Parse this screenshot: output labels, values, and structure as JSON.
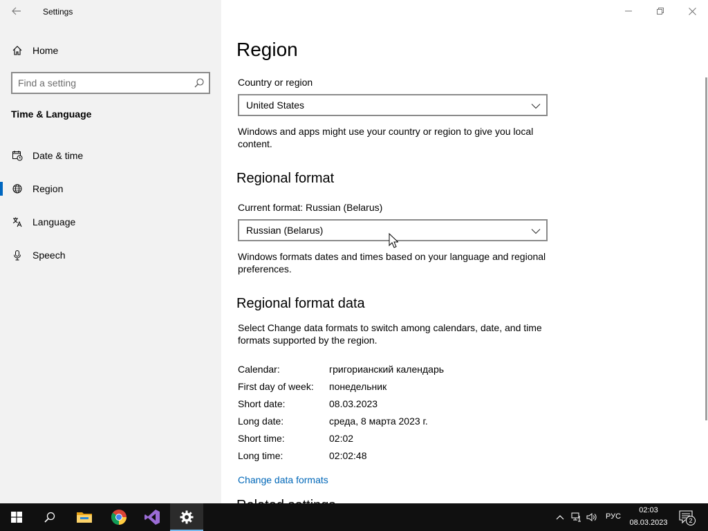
{
  "window": {
    "title": "Settings"
  },
  "sidebar": {
    "home_label": "Home",
    "search_placeholder": "Find a setting",
    "section_title": "Time & Language",
    "items": [
      {
        "label": "Date & time",
        "icon": "calendar-clock-icon"
      },
      {
        "label": "Region",
        "icon": "globe-icon",
        "active": true
      },
      {
        "label": "Language",
        "icon": "language-icon"
      },
      {
        "label": "Speech",
        "icon": "microphone-icon"
      }
    ]
  },
  "main": {
    "title": "Region",
    "country": {
      "label": "Country or region",
      "value": "United States",
      "description": "Windows and apps might use your country or region to give you local content."
    },
    "regional_format": {
      "heading": "Regional format",
      "current_label": "Current format: Russian (Belarus)",
      "value": "Russian (Belarus)",
      "description": "Windows formats dates and times based on your language and regional preferences."
    },
    "format_data": {
      "heading": "Regional format data",
      "description": "Select Change data formats to switch among calendars, date, and time formats supported by the region.",
      "rows": [
        {
          "label": "Calendar:",
          "value": "григорианский календарь"
        },
        {
          "label": "First day of week:",
          "value": "понедельник"
        },
        {
          "label": "Short date:",
          "value": "08.03.2023"
        },
        {
          "label": "Long date:",
          "value": "среда, 8 марта 2023 г."
        },
        {
          "label": "Short time:",
          "value": "02:02"
        },
        {
          "label": "Long time:",
          "value": "02:02:48"
        }
      ],
      "change_link": "Change data formats"
    },
    "related_heading": "Related settings"
  },
  "taskbar": {
    "apps": [
      "start-icon",
      "search-icon",
      "file-explorer-icon",
      "chrome-icon",
      "visual-studio-icon",
      "settings-gear-icon"
    ],
    "language": "РУС",
    "time": "02:03",
    "date": "08.03.2023",
    "notification_count": "2"
  },
  "colors": {
    "accent": "#0067c0",
    "link": "#0067b8",
    "sidebar_bg": "#f2f2f2",
    "taskbar_bg": "#101010"
  }
}
